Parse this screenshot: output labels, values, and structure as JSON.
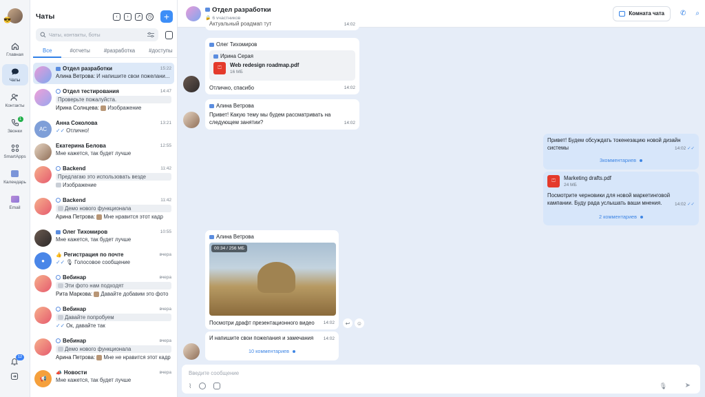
{
  "rail": {
    "avatar_emoji": "😎",
    "items": [
      {
        "label": "Главная"
      },
      {
        "label": "Чаты"
      },
      {
        "label": "Контакты"
      },
      {
        "label": "Звонки",
        "badge": "1"
      },
      {
        "label": "SmartApps"
      },
      {
        "label": "Календарь"
      },
      {
        "label": "Email"
      }
    ],
    "notifications_badge": "12"
  },
  "list": {
    "title": "Чаты",
    "search_placeholder": "Чаты, контакты, боты",
    "tabs": [
      "Все",
      "#отчеты",
      "#разработка",
      "#доступы"
    ],
    "chats": [
      {
        "name": "Отдел разработки",
        "time": "15:22",
        "author": "Алина Ветрова:",
        "text": "И напишите свои пожелани..."
      },
      {
        "name": "Отдел тестирования",
        "time": "14:47",
        "quote": "Проверьте пожалуйста.",
        "author": "Ирина Солнцева:",
        "text": "Изображение"
      },
      {
        "name": "Анна Соколова",
        "initials": "AC",
        "time": "13:21",
        "text": "Отлично!"
      },
      {
        "name": "Екатерина Белова",
        "time": "12:55",
        "text": "Мне кажется, так будет лучше"
      },
      {
        "name": "Backend",
        "time": "11:42",
        "quote": "Предлагаю это использовать везде",
        "text": "Изображение"
      },
      {
        "name": "Backend",
        "time": "11:42",
        "quote": "Демо нового функционала",
        "author": "Арина Петрова:",
        "text": "Мне нравится этот кадр"
      },
      {
        "name": "Олег Тихомиров",
        "time": "10:55",
        "text": "Мне кажется, так будет лучше"
      },
      {
        "name": "Регистрация по почте",
        "time": "вчера",
        "text": "Голосовое сообщение"
      },
      {
        "name": "Вебинар",
        "time": "вчера",
        "quote": "Эти фото нам подходят",
        "author": "Рита Маркова:",
        "text": "Давайте добавим это фото"
      },
      {
        "name": "Вебинар",
        "time": "вчера",
        "quote": "Давайте попробуем",
        "text": "Ок, давайте так"
      },
      {
        "name": "Вебинар",
        "time": "вчера",
        "quote": "Демо нового функционала",
        "author": "Арина Петрова:",
        "text": "Мне не нравится этот кадр"
      },
      {
        "name": "Новости",
        "time": "вчера",
        "text": "Мне кажется, так будет лучше"
      }
    ]
  },
  "chat": {
    "title": "Отдел разработки",
    "subtitle": "6 участников",
    "room_button": "Комната чата",
    "top_fragment": "Актуальный роадмап тут",
    "top_fragment_time": "14:02",
    "m1": {
      "author": "Олег Тихомиров",
      "quote_author": "Ирина Серая",
      "file_name": "Web redesign roadmap.pdf",
      "file_size": "16 МБ",
      "text": "Отлично, спасибо",
      "time": "14:02"
    },
    "m2": {
      "author": "Алина Ветрова",
      "text1": "Привет! Какую тему мы будем рассматривать на",
      "text2": "следующем занятии?",
      "time": "14:02"
    },
    "m3": {
      "text1": "Привет! Будем обсуждать токенезацию новой дизайн",
      "text2": "системы",
      "time": "14:02",
      "comments": "3комментариев"
    },
    "m4": {
      "file_name": "Marketing drafts.pdf",
      "file_size": "24 МБ",
      "text1": "Посмотрите черновики для новой маркетинговой",
      "text2": "кампании. Буду рада услышать ваши мнения.",
      "time": "14:02",
      "comments": "2 комментариев"
    },
    "m5": {
      "author": "Алина Ветрова",
      "video_badge": "00:34 / 256 МБ",
      "text": "Посмотри драфт презентационного видео",
      "time": "14:02"
    },
    "m6": {
      "text": "И напишите свои пожелания и замечания",
      "time": "14:02",
      "comments": "10 комментариев"
    },
    "composer_placeholder": "Введите сообщение"
  }
}
